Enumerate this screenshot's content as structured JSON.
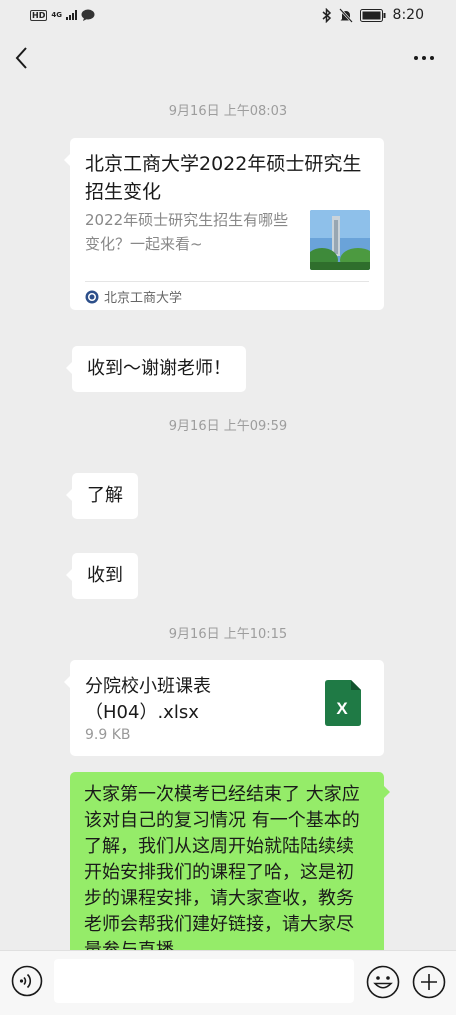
{
  "status": {
    "hd": "HD",
    "net": "4G",
    "time": "8:20"
  },
  "messages": {
    "ts1": "9月16日 上午08:03",
    "card": {
      "title": "北京工商大学2022年硕士研究生招生变化",
      "desc": "2022年硕士研究生招生有哪些变化？一起来看~",
      "source": "北京工商大学"
    },
    "m1": "收到～谢谢老师！",
    "ts2": "9月16日 上午09:59",
    "m2": "了解",
    "m3": "收到",
    "ts3": "9月16日 上午10:15",
    "file": {
      "name": "分院校小班课表（H04）.xlsx",
      "size": "9.9 KB",
      "badge": "X"
    },
    "long": "大家第一次模考已经结束了 大家应该对自己的复习情况 有一个基本的了解，我们从这周开始就陆陆续续开始安排我们的课程了哈，这是初步的课程安排，请大家查收，教务老师会帮我们建好链接，请大家尽量参与直播"
  },
  "input": {
    "value": ""
  }
}
